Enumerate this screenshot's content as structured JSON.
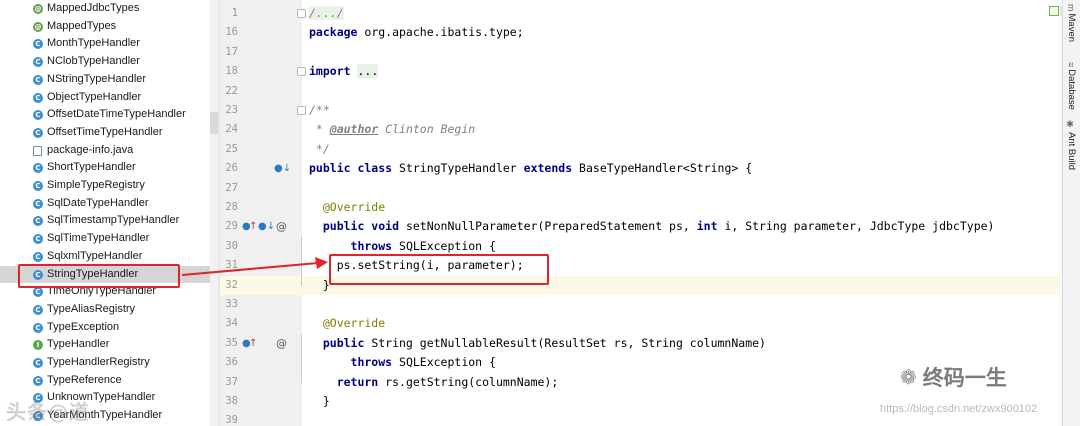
{
  "project_tree": {
    "items": [
      {
        "label": "MappedJdbcTypes",
        "kind": "anno",
        "glyph": "@"
      },
      {
        "label": "MappedTypes",
        "kind": "anno",
        "glyph": "@"
      },
      {
        "label": "MonthTypeHandler",
        "kind": "class",
        "glyph": "C"
      },
      {
        "label": "NClobTypeHandler",
        "kind": "class",
        "glyph": "C"
      },
      {
        "label": "NStringTypeHandler",
        "kind": "class",
        "glyph": "C"
      },
      {
        "label": "ObjectTypeHandler",
        "kind": "class",
        "glyph": "C"
      },
      {
        "label": "OffsetDateTimeTypeHandler",
        "kind": "class",
        "glyph": "C"
      },
      {
        "label": "OffsetTimeTypeHandler",
        "kind": "class",
        "glyph": "C"
      },
      {
        "label": "package-info.java",
        "kind": "file",
        "glyph": ""
      },
      {
        "label": "ShortTypeHandler",
        "kind": "class",
        "glyph": "C"
      },
      {
        "label": "SimpleTypeRegistry",
        "kind": "class",
        "glyph": "C"
      },
      {
        "label": "SqlDateTypeHandler",
        "kind": "class",
        "glyph": "C"
      },
      {
        "label": "SqlTimestampTypeHandler",
        "kind": "class",
        "glyph": "C"
      },
      {
        "label": "SqlTimeTypeHandler",
        "kind": "class",
        "glyph": "C"
      },
      {
        "label": "SqlxmlTypeHandler",
        "kind": "class",
        "glyph": "C"
      },
      {
        "label": "StringTypeHandler",
        "kind": "class",
        "glyph": "C",
        "selected": true
      },
      {
        "label": "TimeOnlyTypeHandler",
        "kind": "class",
        "glyph": "C"
      },
      {
        "label": "TypeAliasRegistry",
        "kind": "class",
        "glyph": "C"
      },
      {
        "label": "TypeException",
        "kind": "class",
        "glyph": "C"
      },
      {
        "label": "TypeHandler",
        "kind": "iface",
        "glyph": "I"
      },
      {
        "label": "TypeHandlerRegistry",
        "kind": "class",
        "glyph": "C"
      },
      {
        "label": "TypeReference",
        "kind": "class",
        "glyph": "C"
      },
      {
        "label": "UnknownTypeHandler",
        "kind": "class",
        "glyph": "C"
      },
      {
        "label": "YearMonthTypeHandler",
        "kind": "class",
        "glyph": "C"
      }
    ]
  },
  "editor": {
    "lines": [
      {
        "num": "1",
        "indent": 0,
        "parts": [
          {
            "t": "/.../",
            "c": "cm folded-hl"
          }
        ],
        "fold": true
      },
      {
        "num": "16",
        "indent": 0,
        "parts": [
          {
            "t": "package",
            "c": "kw"
          },
          {
            "t": " org.apache.ibatis.type;",
            "c": ""
          }
        ]
      },
      {
        "num": "17",
        "indent": 0,
        "parts": []
      },
      {
        "num": "18",
        "indent": 0,
        "parts": [
          {
            "t": "import",
            "c": "kw"
          },
          {
            "t": " ",
            "c": ""
          },
          {
            "t": "...",
            "c": "folded-hl"
          }
        ],
        "fold": true
      },
      {
        "num": "22",
        "indent": 0,
        "parts": []
      },
      {
        "num": "23",
        "indent": 0,
        "parts": [
          {
            "t": "/**",
            "c": "cm"
          }
        ],
        "fold": true
      },
      {
        "num": "24",
        "indent": 0,
        "parts": [
          {
            "t": " * ",
            "c": "cm"
          },
          {
            "t": "@author",
            "c": "doc"
          },
          {
            "t": " Clinton Begin",
            "c": "cm"
          }
        ]
      },
      {
        "num": "25",
        "indent": 0,
        "parts": [
          {
            "t": " */",
            "c": "cm"
          }
        ]
      },
      {
        "num": "26",
        "indent": 0,
        "parts": [
          {
            "t": "public class",
            "c": "kw"
          },
          {
            "t": " StringTypeHandler ",
            "c": ""
          },
          {
            "t": "extends",
            "c": "kw"
          },
          {
            "t": " BaseTypeHandler<String> {",
            "c": ""
          }
        ]
      },
      {
        "num": "27",
        "indent": 0,
        "parts": []
      },
      {
        "num": "28",
        "indent": 0,
        "parts": [
          {
            "t": "  @Override",
            "c": "an"
          }
        ]
      },
      {
        "num": "29",
        "indent": 0,
        "parts": [
          {
            "t": "  public void",
            "c": "kw"
          },
          {
            "t": " setNonNullParameter(PreparedStatement ps, ",
            "c": ""
          },
          {
            "t": "int",
            "c": "kw"
          },
          {
            "t": " i, String parameter, JdbcType jdbcType)",
            "c": ""
          }
        ]
      },
      {
        "num": "30",
        "indent": 0,
        "parts": [
          {
            "t": "      throws",
            "c": "kw"
          },
          {
            "t": " SQLException {",
            "c": ""
          }
        ]
      },
      {
        "num": "31",
        "indent": 0,
        "parts": [
          {
            "t": "    ps.setString(i, parameter);",
            "c": ""
          }
        ]
      },
      {
        "num": "32",
        "indent": 0,
        "parts": [
          {
            "t": "  }",
            "c": ""
          }
        ],
        "current": true
      },
      {
        "num": "33",
        "indent": 0,
        "parts": []
      },
      {
        "num": "34",
        "indent": 0,
        "parts": [
          {
            "t": "  @Override",
            "c": "an"
          }
        ]
      },
      {
        "num": "35",
        "indent": 0,
        "parts": [
          {
            "t": "  public",
            "c": "kw"
          },
          {
            "t": " String getNullableResult(ResultSet rs, String columnName)",
            "c": ""
          }
        ]
      },
      {
        "num": "36",
        "indent": 0,
        "parts": [
          {
            "t": "      throws",
            "c": "kw"
          },
          {
            "t": " SQLException {",
            "c": ""
          }
        ]
      },
      {
        "num": "37",
        "indent": 0,
        "parts": [
          {
            "t": "    return",
            "c": "kw"
          },
          {
            "t": " rs.getString(columnName);",
            "c": ""
          }
        ]
      },
      {
        "num": "38",
        "indent": 0,
        "parts": [
          {
            "t": "  }",
            "c": ""
          }
        ]
      },
      {
        "num": "39",
        "indent": 0,
        "parts": []
      }
    ]
  },
  "tool_windows": [
    {
      "label": "Maven",
      "icon": "maven-icon",
      "glyph": "m"
    },
    {
      "label": "Database",
      "icon": "database-icon",
      "glyph": "≡"
    },
    {
      "label": "Ant Build",
      "icon": "ant-icon",
      "glyph": "✱"
    }
  ],
  "watermarks": {
    "brand": "终码一生",
    "url": "https://blog.csdn.net/zwx900102",
    "left_mark": "头条@道"
  },
  "colors": {
    "highlight_box": "#e0242b",
    "current_line": "#fcfae6",
    "keyword": "#000080",
    "annotation": "#808000"
  }
}
